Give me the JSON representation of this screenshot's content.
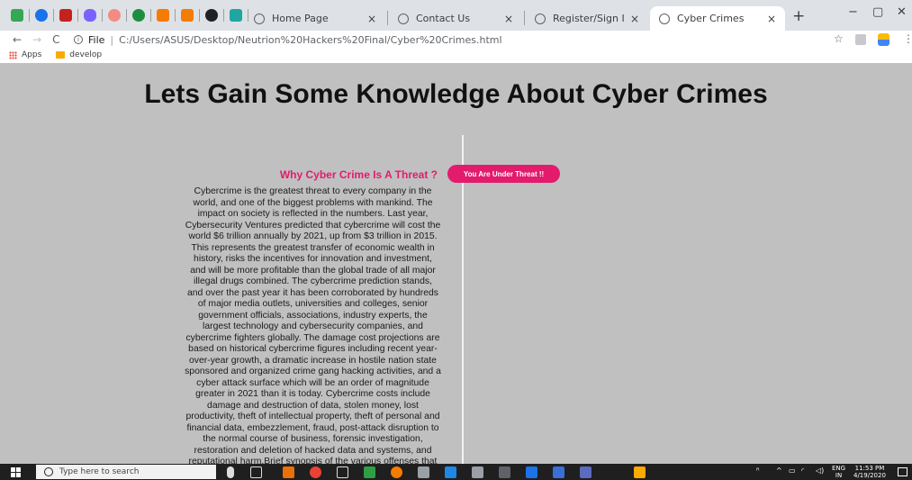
{
  "browser": {
    "tabs": [
      {
        "title": "Home Page",
        "close": "×"
      },
      {
        "title": "Contact Us",
        "close": "×"
      },
      {
        "title": "Register/Sign In",
        "close": "×"
      },
      {
        "title": "Cyber Crimes",
        "close": "×"
      }
    ],
    "new_tab": "+",
    "window_controls": {
      "minimize": "−",
      "maximize": "▢",
      "close": "✕"
    },
    "address": {
      "scheme_label": "File",
      "separator": "|",
      "path": "C:/Users/ASUS/Desktop/Neutrion%20Hackers%20Final/Cyber%20Crimes.html"
    },
    "nav": {
      "back": "←",
      "forward": "→",
      "reload": "C"
    },
    "bookmarks": [
      {
        "label": "Apps"
      },
      {
        "label": "develop"
      }
    ],
    "star": "☆",
    "menu": "⋮"
  },
  "page": {
    "heading": "Lets Gain Some Knowledge About Cyber Crimes",
    "subheading": "Why Cyber Crime Is A Threat ?",
    "threat_button": "You Are Under Threat !!",
    "body": "Cybercrime is the greatest threat to every company in the world, and one of the biggest problems with mankind. The impact on society is reflected in the numbers. Last year, Cybersecurity Ventures predicted that cybercrime will cost the world $6 trillion annually by 2021, up from $3 trillion in 2015. This represents the greatest transfer of economic wealth in history, risks the incentives for innovation and investment, and will be more profitable than the global trade of all major illegal drugs combined. The cybercrime prediction stands, and over the past year it has been corroborated by hundreds of major media outlets, universities and colleges, senior government officials, associations, industry experts, the largest technology and cybersecurity companies, and cybercrime fighters globally. The damage cost projections are based on historical cybercrime figures including recent year-over-year growth, a dramatic increase in hostile nation state sponsored and organized crime gang hacking activities, and a cyber attack surface which will be an order of magnitude greater in 2021 than it is today. Cybercrime costs include damage and destruction of data, stolen money, lost productivity, theft of intellectual property, theft of personal and financial data, embezzlement, fraud, post-attack disruption to the normal course of business, forensic investigation, restoration and deletion of hacked data and systems, and reputational harm.Brief synopsis of the various offenses that constitute computer crime, such as unauthorized intrusion into a"
  },
  "taskbar": {
    "search_placeholder": "Type here to search",
    "language": "ENG",
    "region": "IN",
    "time": "11:53 PM",
    "date": "4/19/2020"
  },
  "colors": {
    "accent": "#e31b6d",
    "page_background": "#c0c0c0",
    "tab_strip": "#dee1e6"
  }
}
